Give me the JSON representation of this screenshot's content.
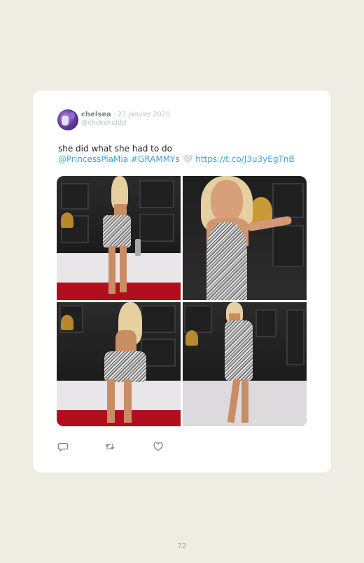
{
  "tweet": {
    "display_name": "chelsea",
    "date": "· 27 janvier 2020",
    "handle": "@chokeholdd",
    "text_line1": "she did what she had to do",
    "mention": "@PrincessPiaMia",
    "hashtag": "#GRAMMYs",
    "heart_emoji": "🤍",
    "link": "https://t.co/J3u3yEgTnB"
  },
  "actions": {
    "reply_icon": "reply-icon",
    "retweet_icon": "retweet-icon",
    "like_icon": "like-icon"
  },
  "page_number": "72",
  "colors": {
    "page_bg": "#eeece3",
    "card_bg": "#ffffff",
    "link": "#3aa3dd",
    "name": "#7a8794",
    "muted": "#b9c0c6"
  }
}
